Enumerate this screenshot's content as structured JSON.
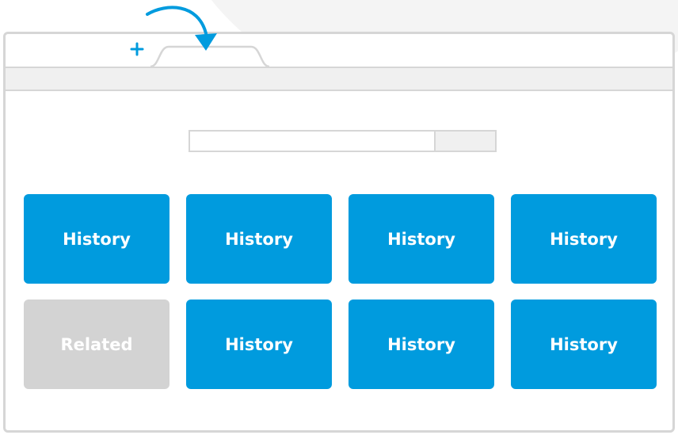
{
  "tiles_row1": [
    "History",
    "History",
    "History",
    "History"
  ],
  "tiles_row2": [
    "Related",
    "History",
    "History",
    "History"
  ],
  "colors": {
    "accent": "#009bde",
    "related": "#d3d3d3",
    "border": "#d6d6d6",
    "toolbar": "#f0f0f0"
  },
  "icons": {
    "new_tab": "plus-icon",
    "move": "curved-arrow-icon"
  }
}
